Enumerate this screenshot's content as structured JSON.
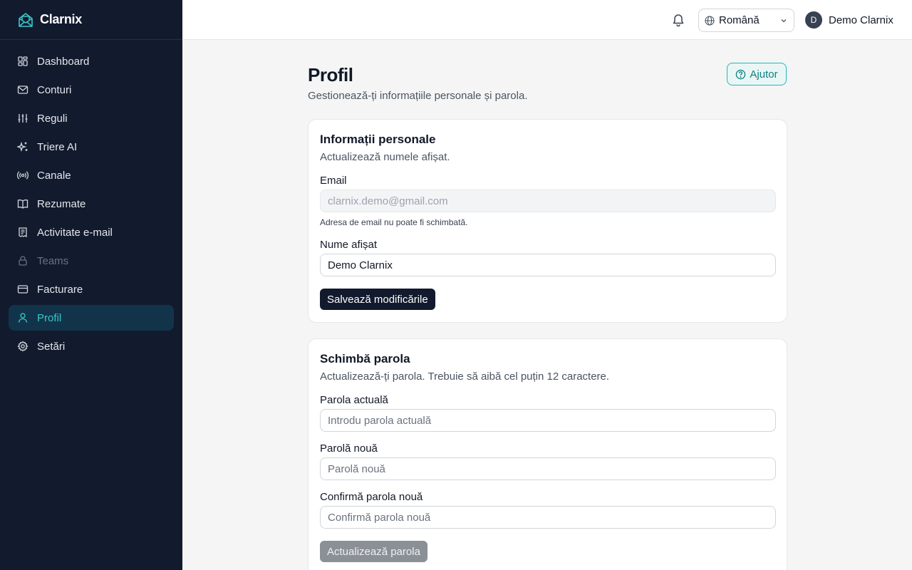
{
  "brand": {
    "name": "Clarnix"
  },
  "sidebar": {
    "items": [
      {
        "label": "Dashboard",
        "icon": "dashboard-icon"
      },
      {
        "label": "Conturi",
        "icon": "mail-icon"
      },
      {
        "label": "Reguli",
        "icon": "sliders-icon"
      },
      {
        "label": "Triere AI",
        "icon": "sparkles-icon"
      },
      {
        "label": "Canale",
        "icon": "radio-icon"
      },
      {
        "label": "Rezumate",
        "icon": "book-icon"
      },
      {
        "label": "Activitate e-mail",
        "icon": "receipt-icon"
      },
      {
        "label": "Teams",
        "icon": "lock-icon"
      },
      {
        "label": "Facturare",
        "icon": "card-icon"
      },
      {
        "label": "Profil",
        "icon": "user-icon"
      },
      {
        "label": "Setări",
        "icon": "gear-icon"
      }
    ],
    "active": "Profil",
    "disabled": "Teams"
  },
  "header": {
    "language": "Română",
    "user_initial": "D",
    "user_name": "Demo Clarnix"
  },
  "page": {
    "title": "Profil",
    "subtitle": "Gestionează-ți informațiile personale și parola.",
    "help_label": "Ajutor"
  },
  "personal": {
    "title": "Informații personale",
    "subtitle": "Actualizează numele afișat.",
    "email_label": "Email",
    "email_value": "clarnix.demo@gmail.com",
    "email_hint": "Adresa de email nu poate fi schimbată.",
    "name_label": "Nume afișat",
    "name_value": "Demo Clarnix",
    "save_label": "Salvează modificările"
  },
  "password": {
    "title": "Schimbă parola",
    "subtitle": "Actualizează-ți parola. Trebuie să aibă cel puțin 12 caractere.",
    "current_label": "Parola actuală",
    "current_placeholder": "Introdu parola actuală",
    "new_label": "Parolă nouă",
    "new_placeholder": "Parolă nouă",
    "confirm_label": "Confirmă parola nouă",
    "confirm_placeholder": "Confirmă parola nouă",
    "update_label": "Actualizează parola"
  },
  "colors": {
    "sidebar_bg": "#121a2e",
    "accent": "#38c7c7",
    "active_bg": "#12344a"
  }
}
